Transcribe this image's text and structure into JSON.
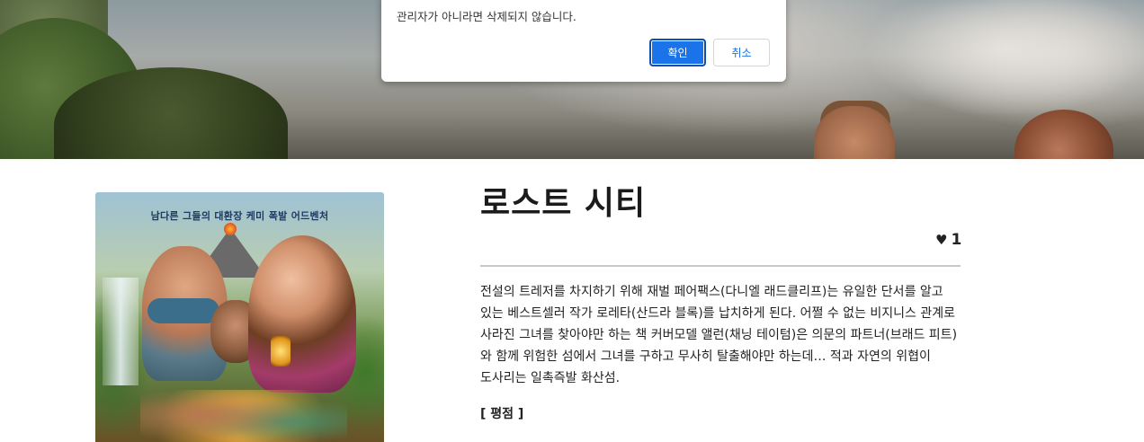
{
  "dialog": {
    "message": "관리자가 아니라면 삭제되지 않습니다.",
    "ok_label": "확인",
    "cancel_label": "취소"
  },
  "poster": {
    "tagline": "남다른 그들의 대환장 케미 폭발 어드벤처"
  },
  "movie": {
    "title": "로스트 시티",
    "heart_icon": "♥",
    "likes": "1",
    "description": "전설의 트레저를 차지하기 위해 재벌 페어팩스(다니엘 래드클리프)는 유일한 단서를 알고 있는 베스트셀러 작가 로레타(산드라 블록)를 납치하게 된다. 어쩔 수 없는 비지니스 관계로 사라진 그녀를 찾아야만 하는 책 커버모델 앨런(채닝 테이텀)은 의문의 파트너(브래드 피트)와 함께 위험한 섬에서 그녀를 구하고 무사히 탈출해야만 하는데… 적과 자연의 위협이 도사리는 일촉즉발 화산섬.",
    "review_heading": "[ 평점 ]"
  },
  "colors": {
    "primary_button": "#1a73e8",
    "divider": "#c8c8c8",
    "text": "#222222"
  }
}
